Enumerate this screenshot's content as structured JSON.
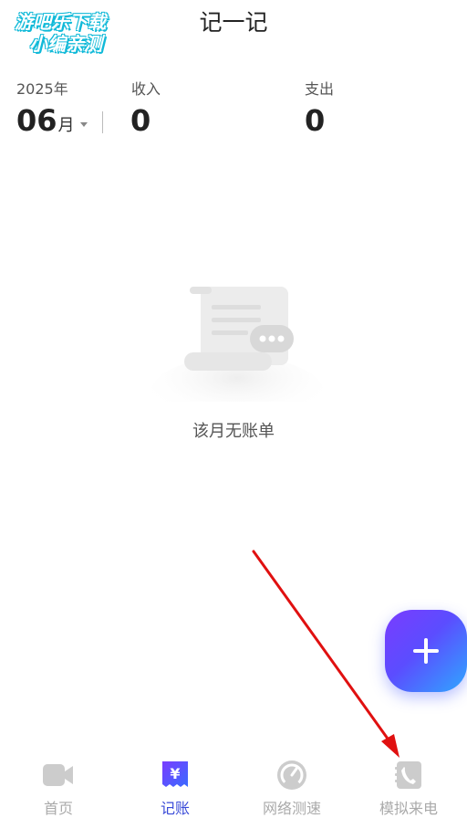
{
  "watermark": {
    "line1": "游吧乐下载",
    "line2": "小编亲测"
  },
  "header": {
    "title": "记一记"
  },
  "summary": {
    "year": "2025年",
    "month": "06",
    "month_unit": "月",
    "income_label": "收入",
    "income_value": "0",
    "expense_label": "支出",
    "expense_value": "0"
  },
  "empty_state": {
    "text": "该月无账单"
  },
  "fab": {
    "icon": "plus-icon"
  },
  "tabs": [
    {
      "label": "首页",
      "icon": "video-camera-icon",
      "active": false
    },
    {
      "label": "记账",
      "icon": "yuan-receipt-icon",
      "active": true
    },
    {
      "label": "网络测速",
      "icon": "speedometer-icon",
      "active": false
    },
    {
      "label": "模拟来电",
      "icon": "phone-book-icon",
      "active": false
    }
  ],
  "colors": {
    "accent": "#3a4bd8",
    "fab_gradient_start": "#7a3cff",
    "fab_gradient_end": "#2fa7ff",
    "tab_inactive": "#cccccc",
    "annotation_arrow": "#e01010"
  }
}
